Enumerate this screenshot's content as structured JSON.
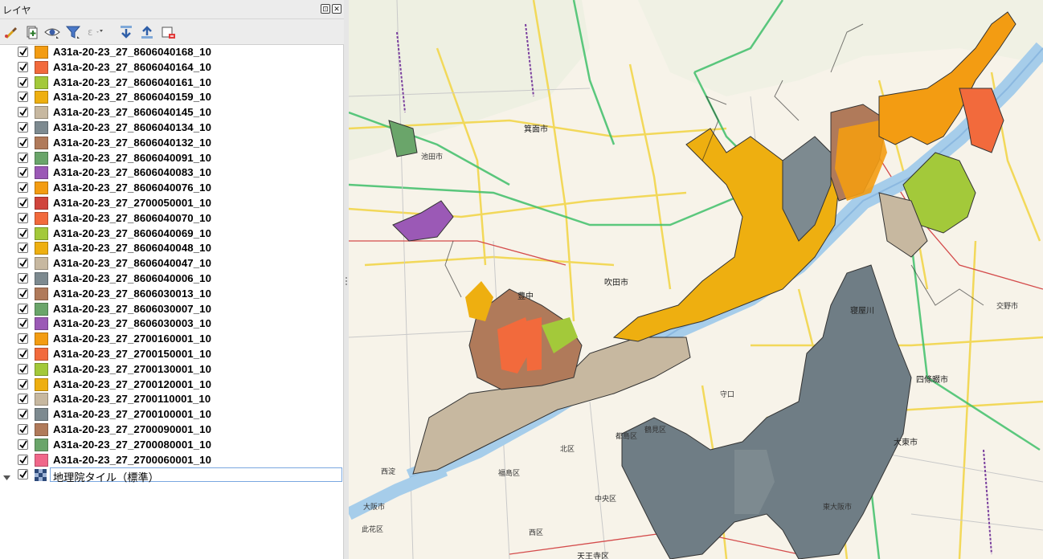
{
  "panel": {
    "title": "レイヤ",
    "float_button": "⊡",
    "close_button": "✕"
  },
  "toolbar": {
    "tools": [
      {
        "name": "style-manager-icon"
      },
      {
        "name": "add-group-icon"
      },
      {
        "name": "visibility-eye-icon"
      },
      {
        "name": "filter-legend-icon"
      },
      {
        "name": "filter-expression-icon"
      },
      {
        "name": "expand-all-icon"
      },
      {
        "name": "collapse-all-icon"
      },
      {
        "name": "remove-layer-icon"
      }
    ]
  },
  "layers": [
    {
      "label": "A31a-20-23_27_8606040168_10",
      "color": "#f39c12",
      "checked": true
    },
    {
      "label": "A31a-20-23_27_8606040164_10",
      "color": "#f26a3c",
      "checked": true
    },
    {
      "label": "A31a-20-23_27_8606040161_10",
      "color": "#a3c93a",
      "checked": true
    },
    {
      "label": "A31a-20-23_27_8606040159_10",
      "color": "#eeaf10",
      "checked": true
    },
    {
      "label": "A31a-20-23_27_8606040145_10",
      "color": "#c7b8a0",
      "checked": true
    },
    {
      "label": "A31a-20-23_27_8606040134_10",
      "color": "#7d8a90",
      "checked": true
    },
    {
      "label": "A31a-20-23_27_8606040132_10",
      "color": "#b07a5a",
      "checked": true
    },
    {
      "label": "A31a-20-23_27_8606040091_10",
      "color": "#6aa56a",
      "checked": true
    },
    {
      "label": "A31a-20-23_27_8606040083_10",
      "color": "#9b59b6",
      "checked": true
    },
    {
      "label": "A31a-20-23_27_8606040076_10",
      "color": "#f39c12",
      "checked": true
    },
    {
      "label": "A31a-20-23_27_2700050001_10",
      "color": "#d0443c",
      "checked": true
    },
    {
      "label": "A31a-20-23_27_8606040070_10",
      "color": "#f26a3c",
      "checked": true
    },
    {
      "label": "A31a-20-23_27_8606040069_10",
      "color": "#a3c93a",
      "checked": true
    },
    {
      "label": "A31a-20-23_27_8606040048_10",
      "color": "#eeaf10",
      "checked": true
    },
    {
      "label": "A31a-20-23_27_8606040047_10",
      "color": "#c7b8a0",
      "checked": true
    },
    {
      "label": "A31a-20-23_27_8606040006_10",
      "color": "#7d8a90",
      "checked": true
    },
    {
      "label": "A31a-20-23_27_8606030013_10",
      "color": "#b07a5a",
      "checked": true
    },
    {
      "label": "A31a-20-23_27_8606030007_10",
      "color": "#6aa56a",
      "checked": true
    },
    {
      "label": "A31a-20-23_27_8606030003_10",
      "color": "#9b59b6",
      "checked": true
    },
    {
      "label": "A31a-20-23_27_2700160001_10",
      "color": "#f39c12",
      "checked": true
    },
    {
      "label": "A31a-20-23_27_2700150001_10",
      "color": "#f26a3c",
      "checked": true
    },
    {
      "label": "A31a-20-23_27_2700130001_10",
      "color": "#a3c93a",
      "checked": true
    },
    {
      "label": "A31a-20-23_27_2700120001_10",
      "color": "#eeaf10",
      "checked": true
    },
    {
      "label": "A31a-20-23_27_2700110001_10",
      "color": "#c7b8a0",
      "checked": true
    },
    {
      "label": "A31a-20-23_27_2700100001_10",
      "color": "#7d8a90",
      "checked": true
    },
    {
      "label": "A31a-20-23_27_2700090001_10",
      "color": "#b07a5a",
      "checked": true
    },
    {
      "label": "A31a-20-23_27_2700080001_10",
      "color": "#6aa56a",
      "checked": true
    },
    {
      "label": "A31a-20-23_27_2700060001_10",
      "color": "#f0678a",
      "checked": true
    }
  ],
  "base_layer": {
    "label": "地理院タイル（標準）",
    "checked": true
  },
  "map": {
    "places": [
      {
        "key": "minoh",
        "text": "箕面市"
      },
      {
        "key": "suita",
        "text": "吹田市"
      },
      {
        "key": "toyonaka",
        "text": "豊中"
      },
      {
        "key": "neyagawa",
        "text": "寝屋川"
      },
      {
        "key": "shijonawate",
        "text": "四條畷市"
      },
      {
        "key": "daito",
        "text": "大東市"
      },
      {
        "key": "higashiosaka",
        "text": "東大阪市"
      },
      {
        "key": "tennoji",
        "text": "天王寺区"
      },
      {
        "key": "chuo",
        "text": "中央区"
      },
      {
        "key": "kita",
        "text": "北区"
      },
      {
        "key": "fukushima",
        "text": "福島区"
      },
      {
        "key": "nishi",
        "text": "西区"
      },
      {
        "key": "osakashi",
        "text": "大阪市"
      },
      {
        "key": "moriguchi",
        "text": "守口"
      },
      {
        "key": "tsurumi",
        "text": "鶴見区"
      },
      {
        "key": "miyakojima",
        "text": "都島区"
      },
      {
        "key": "konohana",
        "text": "此花区"
      },
      {
        "key": "nishiyodo",
        "text": "西淀"
      },
      {
        "key": "katano",
        "text": "交野市"
      },
      {
        "key": "ikeda",
        "text": "池田市"
      }
    ]
  }
}
